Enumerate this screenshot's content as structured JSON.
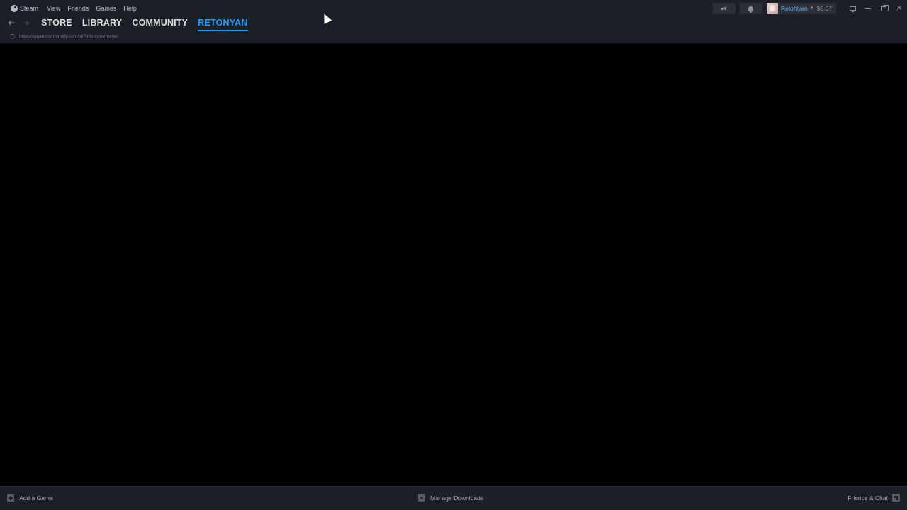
{
  "menubar": {
    "steam": "Steam",
    "view": "View",
    "friends": "Friends",
    "games": "Games",
    "help": "Help"
  },
  "nav": {
    "tabs": [
      {
        "label": "STORE",
        "active": false
      },
      {
        "label": "LIBRARY",
        "active": false
      },
      {
        "label": "COMMUNITY",
        "active": false
      },
      {
        "label": "RETONYAN",
        "active": true
      }
    ],
    "url": "https://steamcommunity.com/id/RetoNyan/home/"
  },
  "account": {
    "username": "RetoNyan",
    "wallet": "$6.07"
  },
  "icons": {
    "announcements": "megaphone-icon",
    "notifications": "bell-icon",
    "big_picture": "monitor-icon",
    "minimize": "minimize-icon",
    "restore": "restore-icon",
    "close": "close-icon"
  },
  "bottombar": {
    "add_game": "Add a Game",
    "manage_downloads": "Manage Downloads",
    "friends_chat": "Friends & Chat"
  },
  "colors": {
    "accent": "#1a9fff",
    "chrome": "#1b1f27",
    "content": "#000000"
  }
}
